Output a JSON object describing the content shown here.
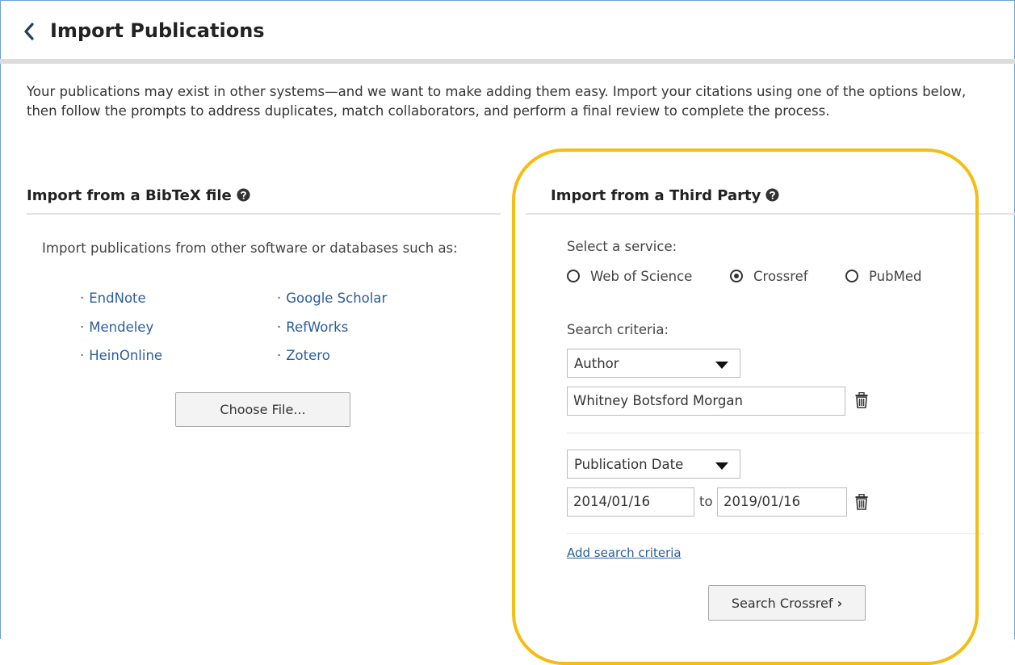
{
  "header": {
    "title": "Import Publications"
  },
  "intro": "Your publications may exist in other systems—and we want to make adding them easy. Import your citations using one of the options below, then follow the prompts to address duplicates, match collaborators, and perform a final review to complete the process.",
  "bibtex": {
    "title": "Import from a BibTeX file",
    "description": "Import publications from other software or databases such as:",
    "sources": [
      "EndNote",
      "Mendeley",
      "HeinOnline",
      "Google Scholar",
      "RefWorks",
      "Zotero"
    ],
    "choose_file_label": "Choose File..."
  },
  "third_party": {
    "title": "Import from a Third Party",
    "select_service_label": "Select a service:",
    "services": [
      {
        "label": "Web of Science",
        "selected": false
      },
      {
        "label": "Crossref",
        "selected": true
      },
      {
        "label": "PubMed",
        "selected": false
      }
    ],
    "search_criteria_label": "Search criteria:",
    "criteria1": {
      "field": "Author",
      "value": "Whitney Botsford Morgan"
    },
    "criteria2": {
      "field": "Publication Date",
      "from": "2014/01/16",
      "to_label": "to",
      "to": "2019/01/16"
    },
    "add_criteria_label": "Add search criteria",
    "search_button_label": "Search Crossref",
    "search_button_chevron": "›"
  },
  "colors": {
    "accent": "#2a5d9f",
    "highlight": "#f5bc12"
  }
}
